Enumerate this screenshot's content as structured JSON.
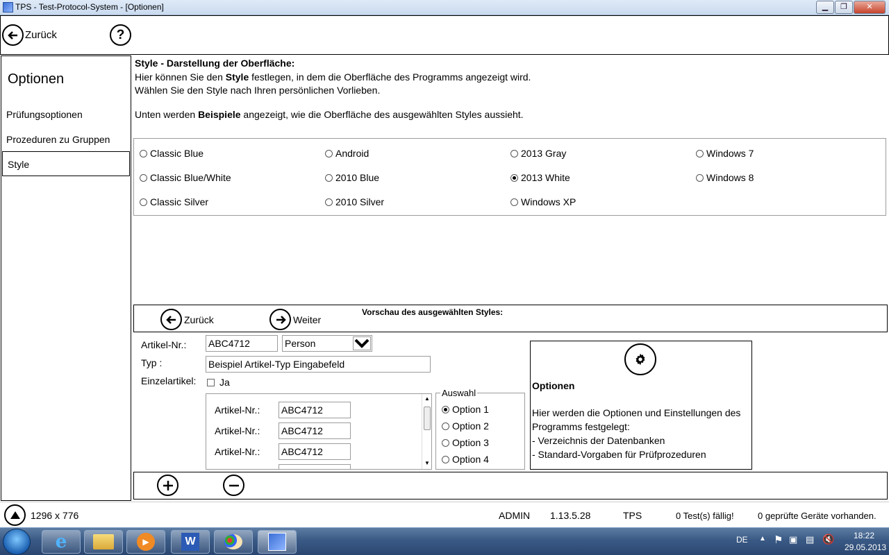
{
  "window": {
    "title": "TPS - Test-Protocol-System - [Optionen]"
  },
  "toolbar": {
    "back_label": "Zurück",
    "help_symbol": "?"
  },
  "sidebar": {
    "heading": "Optionen",
    "items": [
      {
        "label": "Prüfungsoptionen"
      },
      {
        "label": "Prozeduren zu Gruppen"
      },
      {
        "label": "Style"
      }
    ]
  },
  "main": {
    "title": "Style - Darstellung der Oberfläche:",
    "line1_prefix": "Hier können Sie den ",
    "line1_bold": "Style",
    "line1_suffix": " festlegen, in dem die Oberfläche des Programms angezeigt wird.",
    "line2": "Wählen Sie den Style nach Ihren persönlichen Vorlieben.",
    "line3_prefix": "Unten werden ",
    "line3_bold": "Beispiele",
    "line3_suffix": " angezeigt, wie die Oberfläche des ausgewählten Styles aussieht.",
    "styles": [
      {
        "label": "Classic Blue",
        "checked": false
      },
      {
        "label": "Android",
        "checked": false
      },
      {
        "label": "2013 Gray",
        "checked": false
      },
      {
        "label": "Windows 7",
        "checked": false
      },
      {
        "label": "Classic Blue/White",
        "checked": false
      },
      {
        "label": "2010 Blue",
        "checked": false
      },
      {
        "label": "2013 White",
        "checked": true
      },
      {
        "label": "Windows 8",
        "checked": false
      },
      {
        "label": "Classic Silver",
        "checked": false
      },
      {
        "label": "2010 Silver",
        "checked": false
      },
      {
        "label": "Windows XP",
        "checked": false
      }
    ]
  },
  "preview": {
    "back_label": "Zurück",
    "next_label": "Weiter",
    "heading": "Vorschau des ausgewählten Styles:",
    "artikel_label": "Artikel-Nr.:",
    "artikel_value": "ABC4712",
    "combo_value": "Person",
    "typ_label": "Typ :",
    "typ_value": "Beispiel Artikel-Typ Eingabefeld",
    "einzel_label": "Einzelartikel:",
    "einzel_check_label": "Ja",
    "list_rows": [
      {
        "label": "Artikel-Nr.:",
        "value": "ABC4712"
      },
      {
        "label": "Artikel-Nr.:",
        "value": "ABC4712"
      },
      {
        "label": "Artikel-Nr.:",
        "value": "ABC4712"
      }
    ],
    "group_legend": "Auswahl",
    "options": [
      {
        "label": "Option 1",
        "checked": true
      },
      {
        "label": "Option 2",
        "checked": false
      },
      {
        "label": "Option 3",
        "checked": false
      },
      {
        "label": "Option 4",
        "checked": false
      }
    ],
    "info_title": "Optionen",
    "info_line1": "Hier werden die Optionen und Einstellungen des",
    "info_line2": "Programms festgelegt:",
    "info_line3": "- Verzeichnis der Datenbanken",
    "info_line4": "- Standard-Vorgaben für Prüfprozeduren"
  },
  "status": {
    "resolution": "1296 x 776",
    "user": "ADMIN",
    "version": "1.13.5.28",
    "app": "TPS",
    "tests_due": "0 Test(s) fällig!",
    "devices": "0 geprüfte Geräte vorhanden."
  },
  "taskbar": {
    "language": "DE",
    "time": "18:22",
    "date": "29.05.2013"
  }
}
